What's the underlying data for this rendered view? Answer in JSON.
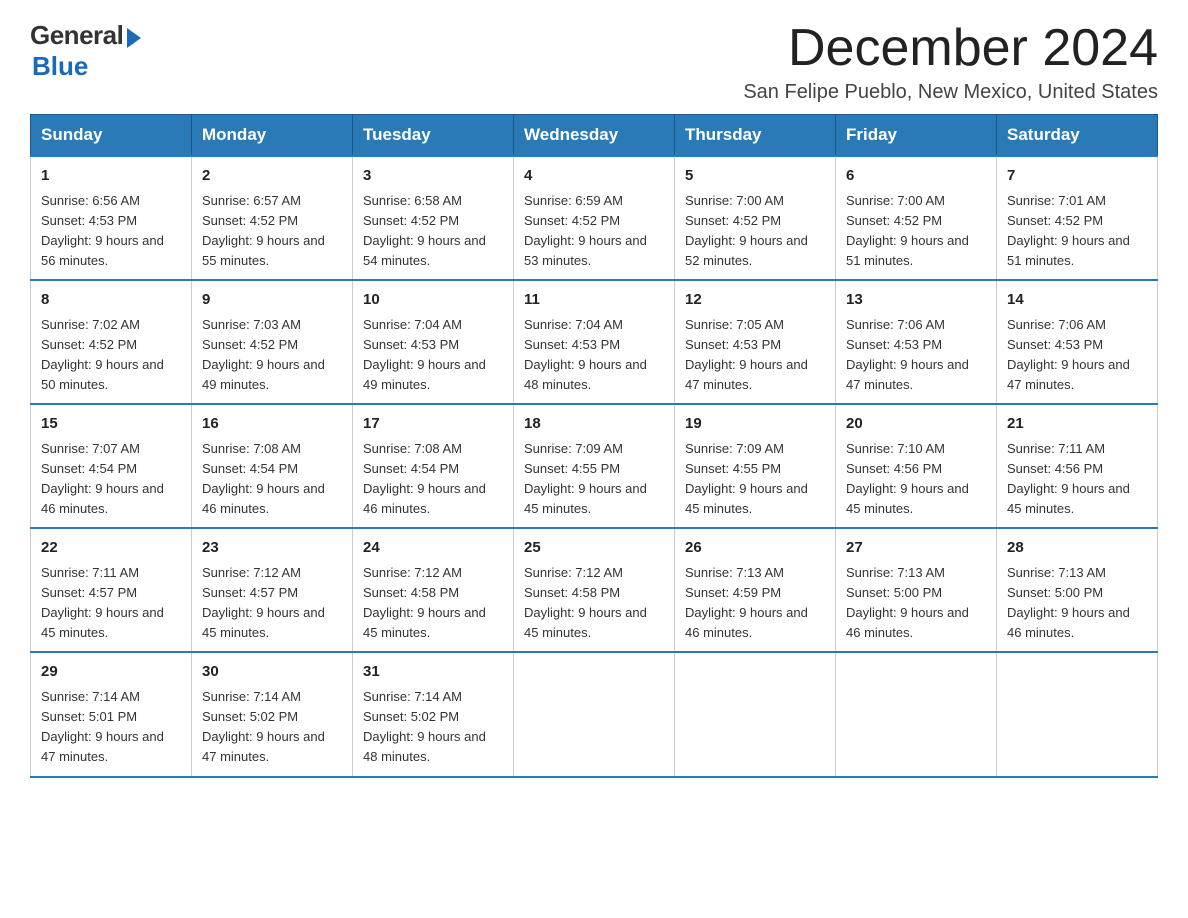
{
  "header": {
    "logo_general": "General",
    "logo_blue": "Blue",
    "month_title": "December 2024",
    "location": "San Felipe Pueblo, New Mexico, United States"
  },
  "weekdays": [
    "Sunday",
    "Monday",
    "Tuesday",
    "Wednesday",
    "Thursday",
    "Friday",
    "Saturday"
  ],
  "weeks": [
    [
      {
        "day": "1",
        "sunrise": "6:56 AM",
        "sunset": "4:53 PM",
        "daylight": "9 hours and 56 minutes."
      },
      {
        "day": "2",
        "sunrise": "6:57 AM",
        "sunset": "4:52 PM",
        "daylight": "9 hours and 55 minutes."
      },
      {
        "day": "3",
        "sunrise": "6:58 AM",
        "sunset": "4:52 PM",
        "daylight": "9 hours and 54 minutes."
      },
      {
        "day": "4",
        "sunrise": "6:59 AM",
        "sunset": "4:52 PM",
        "daylight": "9 hours and 53 minutes."
      },
      {
        "day": "5",
        "sunrise": "7:00 AM",
        "sunset": "4:52 PM",
        "daylight": "9 hours and 52 minutes."
      },
      {
        "day": "6",
        "sunrise": "7:00 AM",
        "sunset": "4:52 PM",
        "daylight": "9 hours and 51 minutes."
      },
      {
        "day": "7",
        "sunrise": "7:01 AM",
        "sunset": "4:52 PM",
        "daylight": "9 hours and 51 minutes."
      }
    ],
    [
      {
        "day": "8",
        "sunrise": "7:02 AM",
        "sunset": "4:52 PM",
        "daylight": "9 hours and 50 minutes."
      },
      {
        "day": "9",
        "sunrise": "7:03 AM",
        "sunset": "4:52 PM",
        "daylight": "9 hours and 49 minutes."
      },
      {
        "day": "10",
        "sunrise": "7:04 AM",
        "sunset": "4:53 PM",
        "daylight": "9 hours and 49 minutes."
      },
      {
        "day": "11",
        "sunrise": "7:04 AM",
        "sunset": "4:53 PM",
        "daylight": "9 hours and 48 minutes."
      },
      {
        "day": "12",
        "sunrise": "7:05 AM",
        "sunset": "4:53 PM",
        "daylight": "9 hours and 47 minutes."
      },
      {
        "day": "13",
        "sunrise": "7:06 AM",
        "sunset": "4:53 PM",
        "daylight": "9 hours and 47 minutes."
      },
      {
        "day": "14",
        "sunrise": "7:06 AM",
        "sunset": "4:53 PM",
        "daylight": "9 hours and 47 minutes."
      }
    ],
    [
      {
        "day": "15",
        "sunrise": "7:07 AM",
        "sunset": "4:54 PM",
        "daylight": "9 hours and 46 minutes."
      },
      {
        "day": "16",
        "sunrise": "7:08 AM",
        "sunset": "4:54 PM",
        "daylight": "9 hours and 46 minutes."
      },
      {
        "day": "17",
        "sunrise": "7:08 AM",
        "sunset": "4:54 PM",
        "daylight": "9 hours and 46 minutes."
      },
      {
        "day": "18",
        "sunrise": "7:09 AM",
        "sunset": "4:55 PM",
        "daylight": "9 hours and 45 minutes."
      },
      {
        "day": "19",
        "sunrise": "7:09 AM",
        "sunset": "4:55 PM",
        "daylight": "9 hours and 45 minutes."
      },
      {
        "day": "20",
        "sunrise": "7:10 AM",
        "sunset": "4:56 PM",
        "daylight": "9 hours and 45 minutes."
      },
      {
        "day": "21",
        "sunrise": "7:11 AM",
        "sunset": "4:56 PM",
        "daylight": "9 hours and 45 minutes."
      }
    ],
    [
      {
        "day": "22",
        "sunrise": "7:11 AM",
        "sunset": "4:57 PM",
        "daylight": "9 hours and 45 minutes."
      },
      {
        "day": "23",
        "sunrise": "7:12 AM",
        "sunset": "4:57 PM",
        "daylight": "9 hours and 45 minutes."
      },
      {
        "day": "24",
        "sunrise": "7:12 AM",
        "sunset": "4:58 PM",
        "daylight": "9 hours and 45 minutes."
      },
      {
        "day": "25",
        "sunrise": "7:12 AM",
        "sunset": "4:58 PM",
        "daylight": "9 hours and 45 minutes."
      },
      {
        "day": "26",
        "sunrise": "7:13 AM",
        "sunset": "4:59 PM",
        "daylight": "9 hours and 46 minutes."
      },
      {
        "day": "27",
        "sunrise": "7:13 AM",
        "sunset": "5:00 PM",
        "daylight": "9 hours and 46 minutes."
      },
      {
        "day": "28",
        "sunrise": "7:13 AM",
        "sunset": "5:00 PM",
        "daylight": "9 hours and 46 minutes."
      }
    ],
    [
      {
        "day": "29",
        "sunrise": "7:14 AM",
        "sunset": "5:01 PM",
        "daylight": "9 hours and 47 minutes."
      },
      {
        "day": "30",
        "sunrise": "7:14 AM",
        "sunset": "5:02 PM",
        "daylight": "9 hours and 47 minutes."
      },
      {
        "day": "31",
        "sunrise": "7:14 AM",
        "sunset": "5:02 PM",
        "daylight": "9 hours and 48 minutes."
      },
      null,
      null,
      null,
      null
    ]
  ]
}
